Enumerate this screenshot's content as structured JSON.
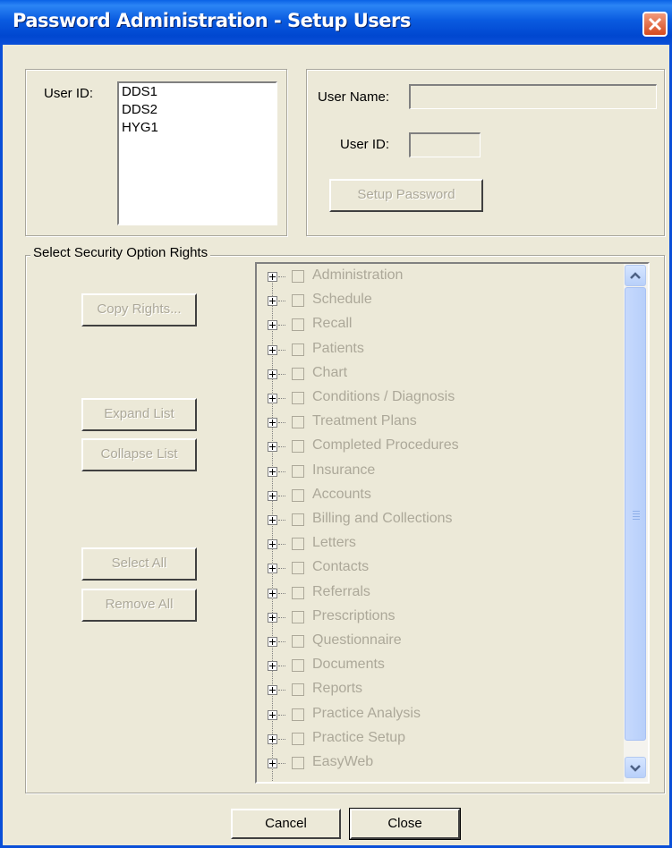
{
  "window": {
    "title": "Password Administration - Setup Users"
  },
  "users_panel": {
    "label": "User ID:",
    "users": [
      "DDS1",
      "DDS2",
      "HYG1"
    ]
  },
  "details_panel": {
    "user_name_label": "User Name:",
    "user_name_value": "",
    "user_id_label": "User ID:",
    "user_id_value": "",
    "setup_password_label": "Setup Password"
  },
  "security": {
    "legend": "Select Security Option Rights",
    "copy_rights_label": "Copy Rights...",
    "expand_list_label": "Expand List",
    "collapse_list_label": "Collapse List",
    "select_all_label": "Select All",
    "remove_all_label": "Remove All",
    "tree_items": [
      "Administration",
      "Schedule",
      "Recall",
      "Patients",
      "Chart",
      "Conditions / Diagnosis",
      "Treatment Plans",
      "Completed Procedures",
      "Insurance",
      "Accounts",
      "Billing and Collections",
      "Letters",
      "Contacts",
      "Referrals",
      "Prescriptions",
      "Questionnaire",
      "Documents",
      "Reports",
      "Practice Analysis",
      "Practice Setup",
      "EasyWeb"
    ]
  },
  "footer": {
    "cancel_label": "Cancel",
    "close_label": "Close"
  }
}
